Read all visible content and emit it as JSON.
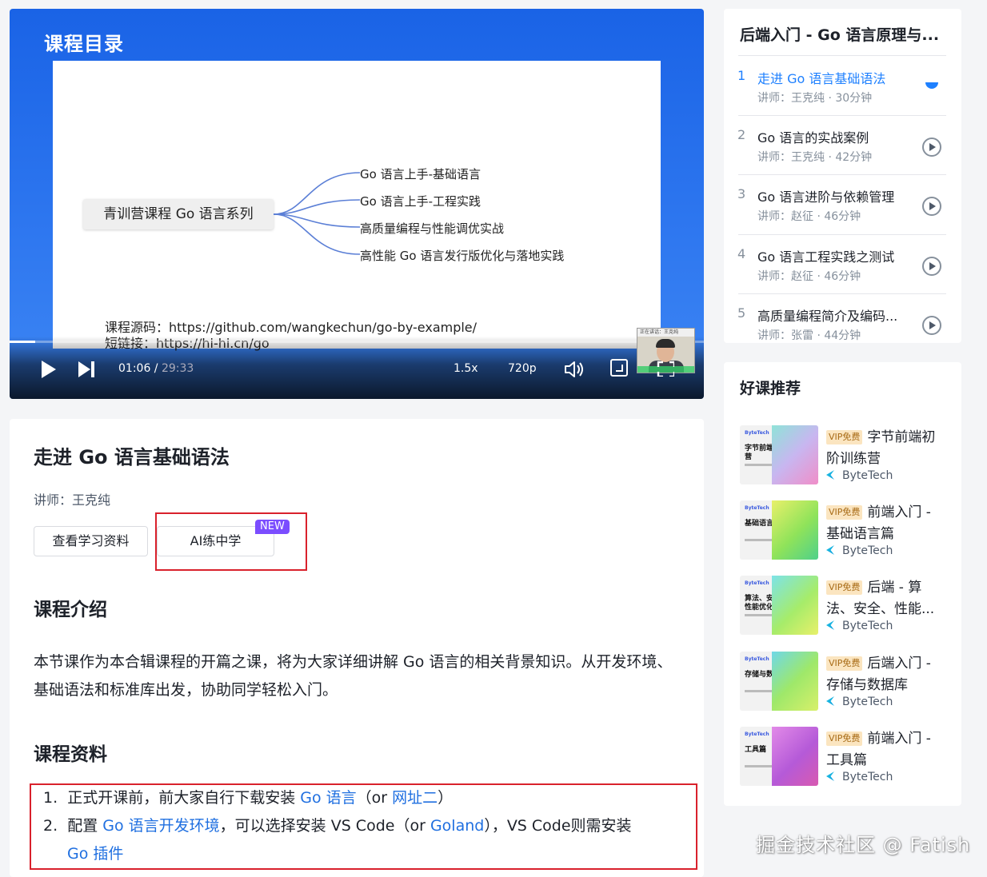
{
  "video": {
    "slide_title": "课程目录",
    "mindmap_root": "青训营课程 Go 语言系列",
    "mindmap_branches": [
      "Go 语言上手-基础语言",
      "Go 语言上手-工程实践",
      "高质量编程与性能调优实战",
      "高性能 Go 语言发行版优化与落地实践"
    ],
    "source_line": "课程源码：https://github.com/wangkechun/go-by-example/",
    "short_link_line": "短链接：https://hi-hi.cn/go",
    "pip_label": "正在讲话：王克纯",
    "progress_fraction": 0.037,
    "current_time": "01:06",
    "time_separator": " / ",
    "total_time": "29:33",
    "speed": "1.5x",
    "quality": "720p"
  },
  "lesson": {
    "title": "走进 Go 语言基础语法",
    "teacher": "讲师：王克纯",
    "btn_materials": "查看学习资料",
    "btn_ai": "AI练中学",
    "badge_new": "NEW",
    "intro_heading": "课程介绍",
    "intro_text": "本节课作为本合辑课程的开篇之课，将为大家详细讲解 Go 语言的相关背景知识。从开发环境、基础语法和标准库出发，协助同学轻松入门。",
    "materials_heading": "课程资料",
    "materials": {
      "item1": {
        "num": "1.",
        "pre": "正式开课前，前大家自行下载安装 ",
        "link1": "Go 语言",
        "mid": "（or ",
        "link2": "网址二",
        "post": "）"
      },
      "item2": {
        "num": "2.",
        "pre": "配置 ",
        "link1": "Go 语言开发环境",
        "mid": "，可以选择安装 VS Code（or ",
        "link2": "Goland",
        "post": "），VS Code则需安装",
        "link3": "Go 插件"
      }
    }
  },
  "playlist": {
    "title": "后端入门 - Go 语言原理与...",
    "items": [
      {
        "num": "1",
        "name": "走进 Go 语言基础语法",
        "meta": "讲师：王克纯 · 30分钟",
        "active": true
      },
      {
        "num": "2",
        "name": "Go 语言的实战案例",
        "meta": "讲师：王克纯 · 42分钟",
        "active": false
      },
      {
        "num": "3",
        "name": "Go 语言进阶与依赖管理",
        "meta": "讲师：赵征 · 46分钟",
        "active": false
      },
      {
        "num": "4",
        "name": "Go 语言工程实践之测试",
        "meta": "讲师：赵征 · 46分钟",
        "active": false
      },
      {
        "num": "5",
        "name": "高质量编程简介及编码...",
        "meta": "讲师：张雷 · 44分钟",
        "active": false
      }
    ]
  },
  "recommend": {
    "heading": "好课推荐",
    "vip_label": "VIP免费",
    "brand": "ByteTech",
    "items": [
      {
        "title": "字节前端初阶训练营",
        "thumb_text": "字节前端训练营"
      },
      {
        "title": "前端入门 - 基础语言篇",
        "thumb_text": "基础语言篇"
      },
      {
        "title": "后端 - 算法、安全、性能...",
        "thumb_text": "算法、安全、性能优化"
      },
      {
        "title": "后端入门 - 存储与数据库",
        "thumb_text": "存储与数据库"
      },
      {
        "title": "前端入门 - 工具篇",
        "thumb_text": "工具篇"
      }
    ]
  },
  "watermark": "掘金技术社区 @ Fatish",
  "colors": {
    "accent": "#1e80ff",
    "link": "#1f6fe0",
    "highlight_box": "#d9212c",
    "badge_new": "#7b4dff",
    "vip_bg": "#fbe5c0"
  }
}
